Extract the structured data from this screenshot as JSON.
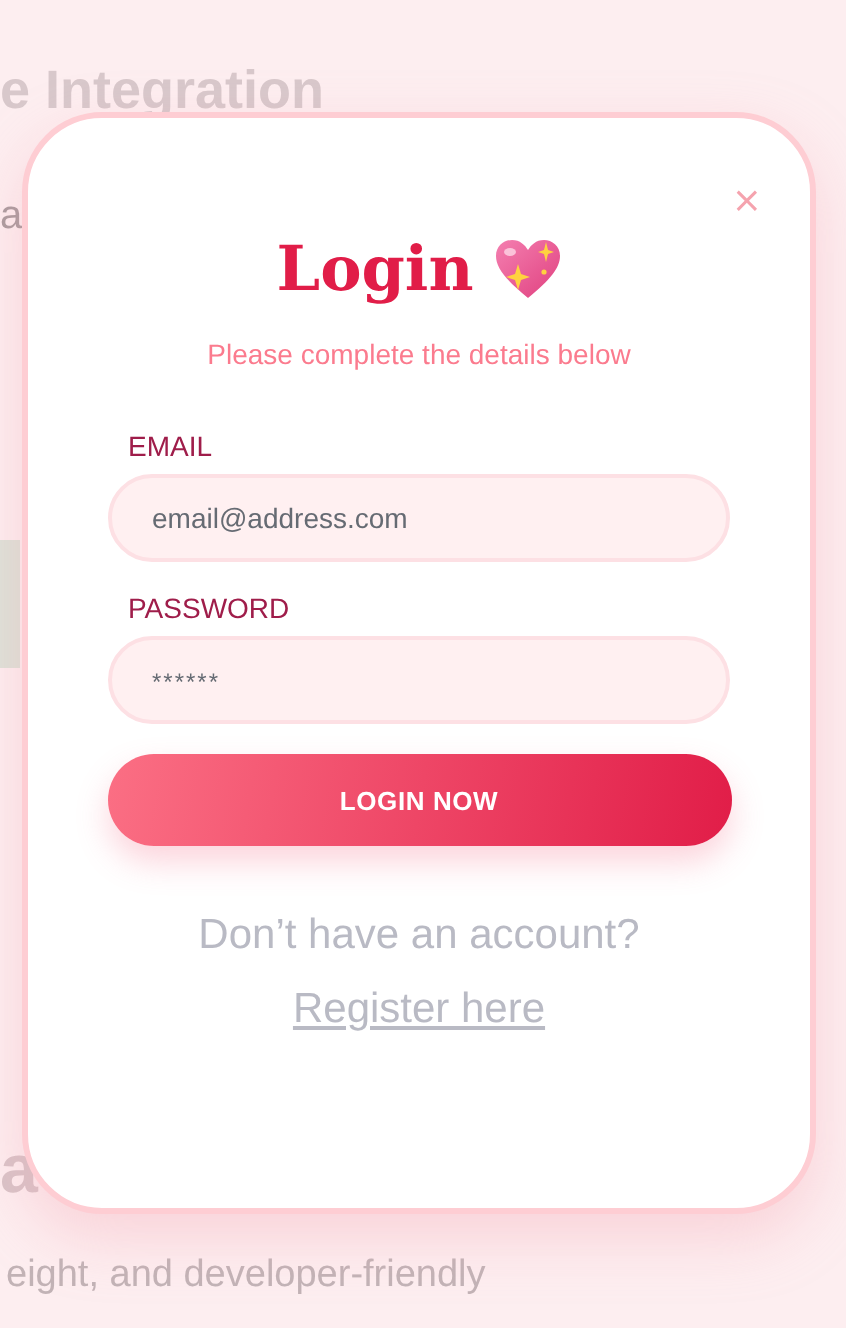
{
  "background": {
    "heading": "e Integration",
    "text_1": "a",
    "heading_2": "a",
    "text_2": "eight, and developer-friendly"
  },
  "modal": {
    "close": "×",
    "title": "Login",
    "subtitle": "Please complete the details below",
    "fields": [
      {
        "kind": "email",
        "label": "EMAIL",
        "placeholder": "email@address.com"
      },
      {
        "kind": "password",
        "label": "PASSWORD",
        "placeholder": "******"
      }
    ],
    "button": "LOGIN NOW",
    "footer": {
      "text": "Don’t have an account?",
      "link": "Register here"
    }
  }
}
